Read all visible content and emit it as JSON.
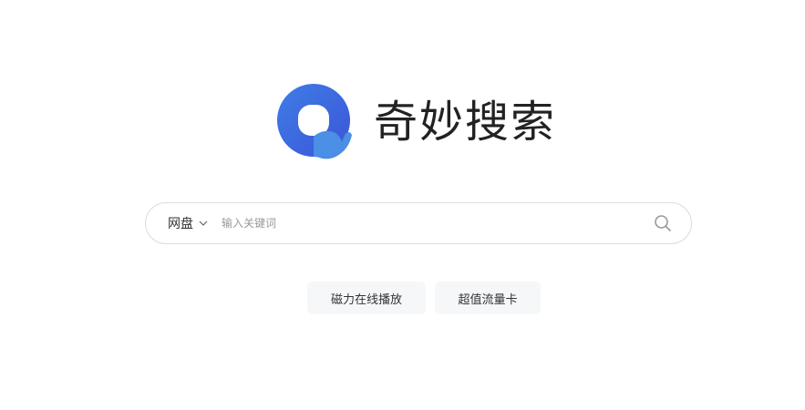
{
  "brand": {
    "title": "奇妙搜索",
    "logo_icon": "q-logo-icon",
    "logo_colors": {
      "primary": "#3d6be0",
      "accent": "#4a90e2",
      "inner": "#ffffff"
    }
  },
  "search": {
    "scope_label": "网盘",
    "scope_icon": "chevron-down-icon",
    "placeholder": "输入关键词",
    "value": "",
    "search_icon": "search-icon"
  },
  "quick_links": [
    {
      "label": "磁力在线播放"
    },
    {
      "label": "超值流量卡"
    }
  ]
}
